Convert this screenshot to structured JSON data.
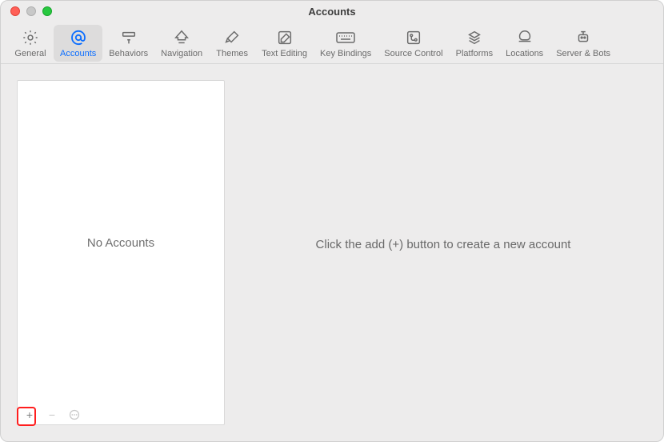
{
  "window": {
    "title": "Accounts"
  },
  "tabs": [
    {
      "id": "general",
      "label": "General"
    },
    {
      "id": "accounts",
      "label": "Accounts"
    },
    {
      "id": "behaviors",
      "label": "Behaviors"
    },
    {
      "id": "navigation",
      "label": "Navigation"
    },
    {
      "id": "themes",
      "label": "Themes"
    },
    {
      "id": "text-editing",
      "label": "Text Editing"
    },
    {
      "id": "key-bindings",
      "label": "Key Bindings"
    },
    {
      "id": "source-control",
      "label": "Source Control"
    },
    {
      "id": "platforms",
      "label": "Platforms"
    },
    {
      "id": "locations",
      "label": "Locations"
    },
    {
      "id": "server-bots",
      "label": "Server & Bots"
    }
  ],
  "sidebar": {
    "empty_text": "No Accounts"
  },
  "detail": {
    "empty_text": "Click the add (+) button to create a new account"
  },
  "footer": {
    "add_symbol": "+",
    "remove_symbol": "−",
    "more_symbol": "⋯"
  }
}
